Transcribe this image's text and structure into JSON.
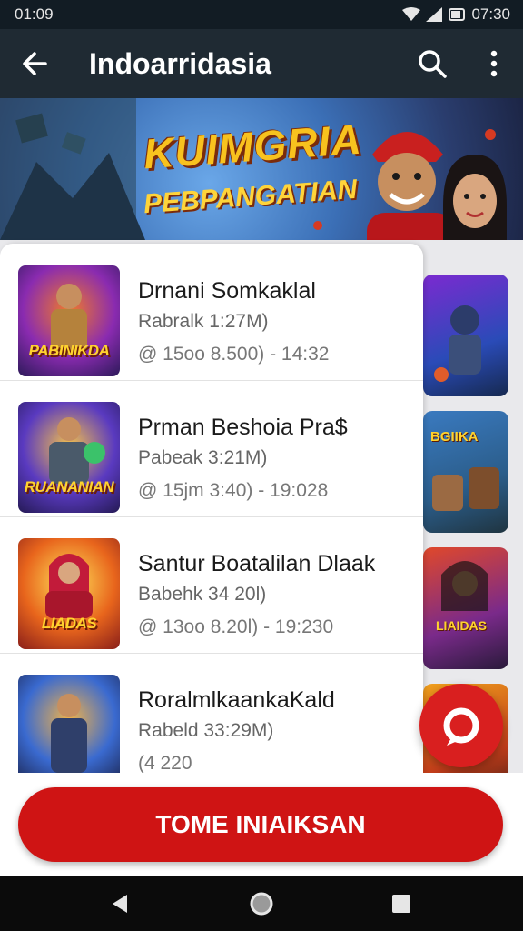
{
  "status": {
    "time": "01:09",
    "right_time": "07:30"
  },
  "appbar": {
    "title": "Indoarridasia"
  },
  "banner": {
    "line1": "KUIMGRIA",
    "line2": "PEBPANGATIAN"
  },
  "items": [
    {
      "title": "Drnani Somkaklal",
      "subtitle": "Rabralk 1:27M)",
      "meta": "@ 15oo   8.500) - 14:32",
      "thumb_caption": "PABINIKDA"
    },
    {
      "title": "Prman Beshoia Pra$",
      "subtitle": "Pabeak 3:21M)",
      "meta": "@ 15jm   3:40) - 19:028",
      "thumb_caption": "RUANANIAN"
    },
    {
      "title": "Santur Boatalilan Dlaak",
      "subtitle": "Babehk 34 20l)",
      "meta": "@ 13oo   8.20l) - 19:230",
      "thumb_caption": "LIADAS"
    },
    {
      "title": "RoralmlkaankaKald",
      "subtitle": "Rabeld 33:29M)",
      "meta": "(4 220",
      "thumb_caption": ""
    }
  ],
  "bgcards": [
    "",
    "BGIIKA",
    "LIAIDAS",
    ""
  ],
  "cta": {
    "label": "TOME INIAIKSAN"
  },
  "colors": {
    "accent": "#cf1414",
    "appbar": "#1f2a33",
    "status": "#121c24"
  }
}
